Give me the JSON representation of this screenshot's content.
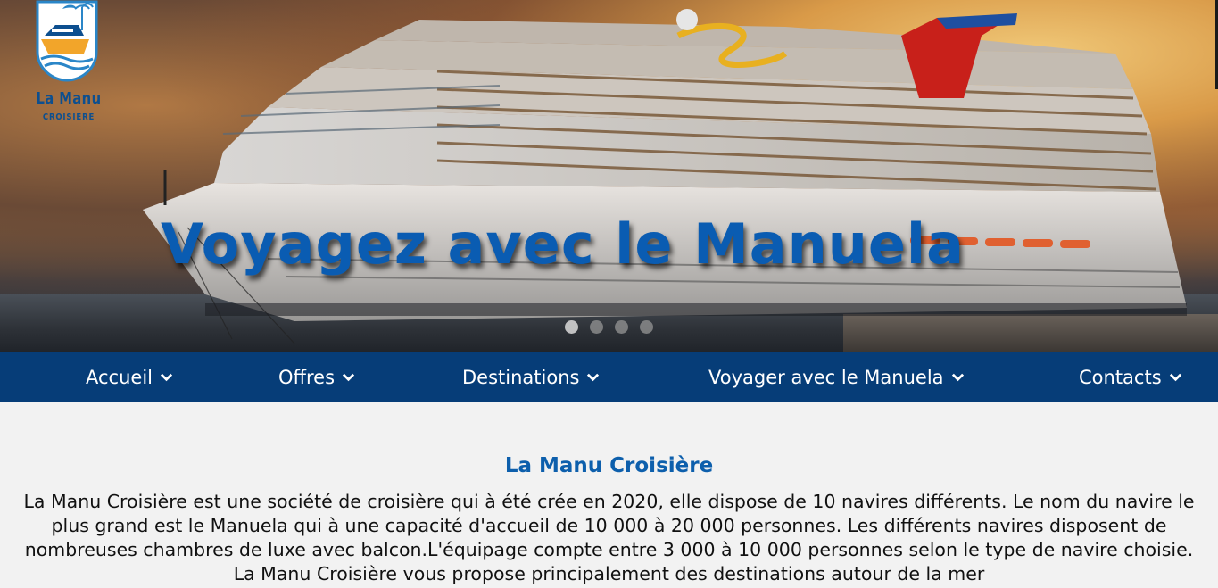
{
  "brand": {
    "name": "La Manu",
    "subtitle": "CROISIÈRE"
  },
  "hero": {
    "title": "Voyagez avec le Manuela",
    "slides": 4,
    "active_slide": 1
  },
  "nav": {
    "items": [
      {
        "label": "Accueil",
        "icon": "chevron-down-icon"
      },
      {
        "label": "Offres",
        "icon": "chevron-down-icon"
      },
      {
        "label": "Destinations",
        "icon": "chevron-down-icon"
      },
      {
        "label": "Voyager avec le Manuela",
        "icon": "chevron-down-icon"
      },
      {
        "label": "Contacts",
        "icon": "chevron-down-icon"
      }
    ]
  },
  "main": {
    "title": "La Manu Croisière",
    "intro": "La Manu Croisière est une société de croisière qui à été crée en 2020, elle dispose de 10 navires différents. Le nom du navire le plus grand est le Manuela qui à une capacité d'accueil de 10 000 à 20 000 personnes. Les différents navires disposent de nombreuses chambres de luxe avec balcon.L'équipage compte entre 3 000 à 10 000 personnes selon le type de navire choisie. La Manu Croisière vous propose principalement des destinations autour de la mer"
  },
  "colors": {
    "nav_bg": "#063d78",
    "accent": "#0d5fac",
    "hero_title": "#0a5cb2",
    "page_bg": "#f2f2f2"
  }
}
